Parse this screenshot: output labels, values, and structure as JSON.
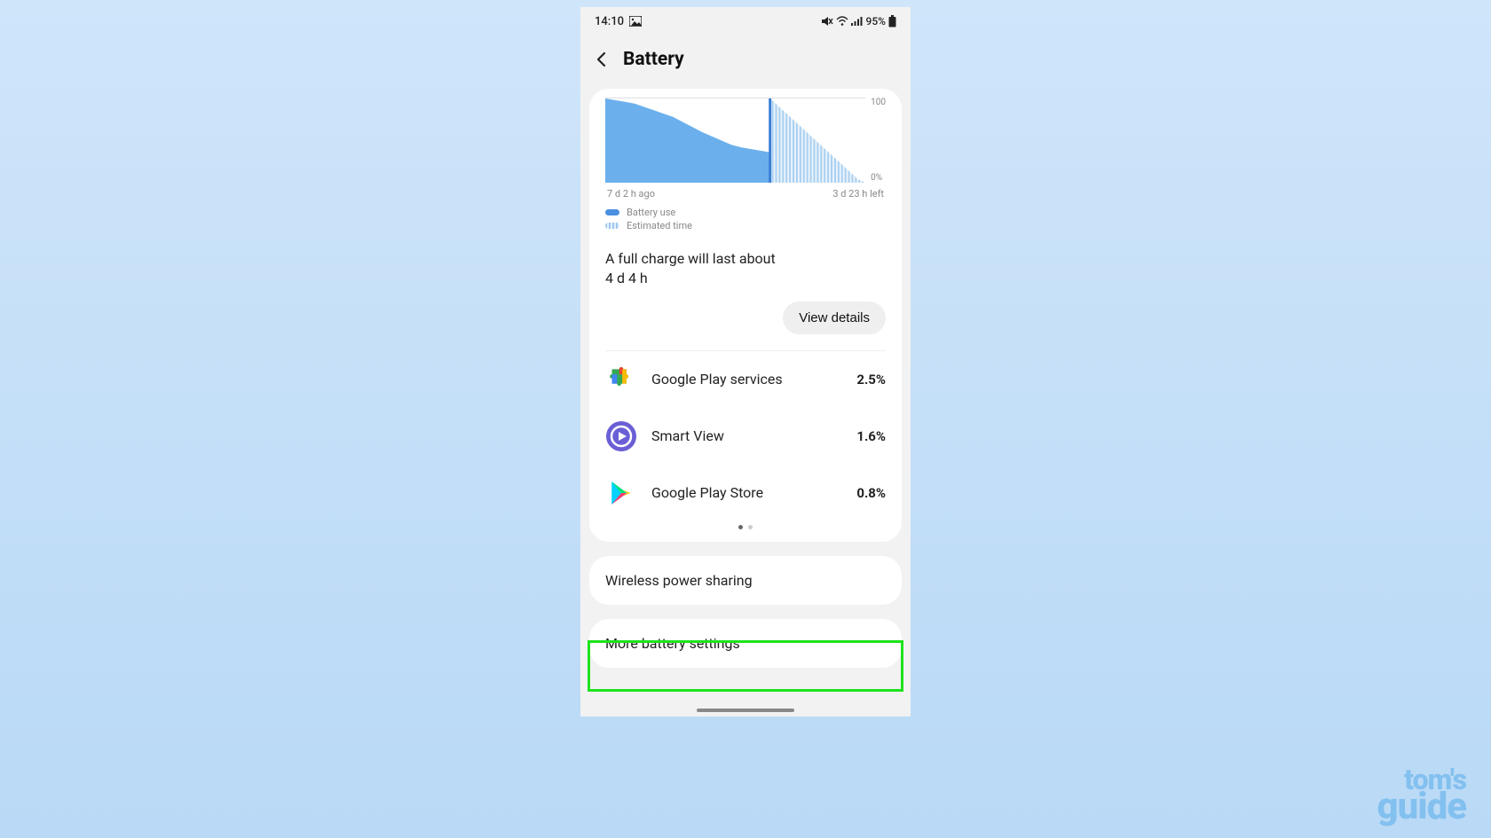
{
  "status": {
    "time": "14:10",
    "battery_pct": "95%"
  },
  "header": {
    "title": "Battery"
  },
  "chart_data": {
    "type": "area",
    "ylim": [
      0,
      100
    ],
    "ylabels": {
      "top": "100",
      "bottom": "0%"
    },
    "xlabels": {
      "left": "7 d 2 h ago",
      "right": "3 d 23 h left"
    },
    "series": [
      {
        "name": "Battery use",
        "style": "solid",
        "values": [
          100,
          98,
          96,
          94,
          90,
          86,
          82,
          78,
          72,
          66,
          60,
          55,
          50,
          45,
          42,
          40,
          38,
          36
        ]
      },
      {
        "name": "Estimated time",
        "style": "hatch",
        "values": [
          100,
          92,
          84,
          76,
          68,
          60,
          52,
          44,
          36,
          28,
          20,
          12,
          4,
          0
        ]
      }
    ],
    "legend": [
      "Battery use",
      "Estimated time"
    ]
  },
  "estimate": {
    "line1": "A full charge will last about",
    "line2": "4 d 4 h"
  },
  "buttons": {
    "view_details": "View details"
  },
  "apps": [
    {
      "name": "Google Play services",
      "pct": "2.5%",
      "icon": "puzzle"
    },
    {
      "name": "Smart View",
      "pct": "1.6%",
      "icon": "smartview"
    },
    {
      "name": "Google Play Store",
      "pct": "0.8%",
      "icon": "playstore"
    }
  ],
  "menu": {
    "wireless_power_sharing": "Wireless power sharing",
    "more_battery_settings": "More battery settings"
  },
  "logo": {
    "line1": "tom's",
    "line2": "guide"
  }
}
